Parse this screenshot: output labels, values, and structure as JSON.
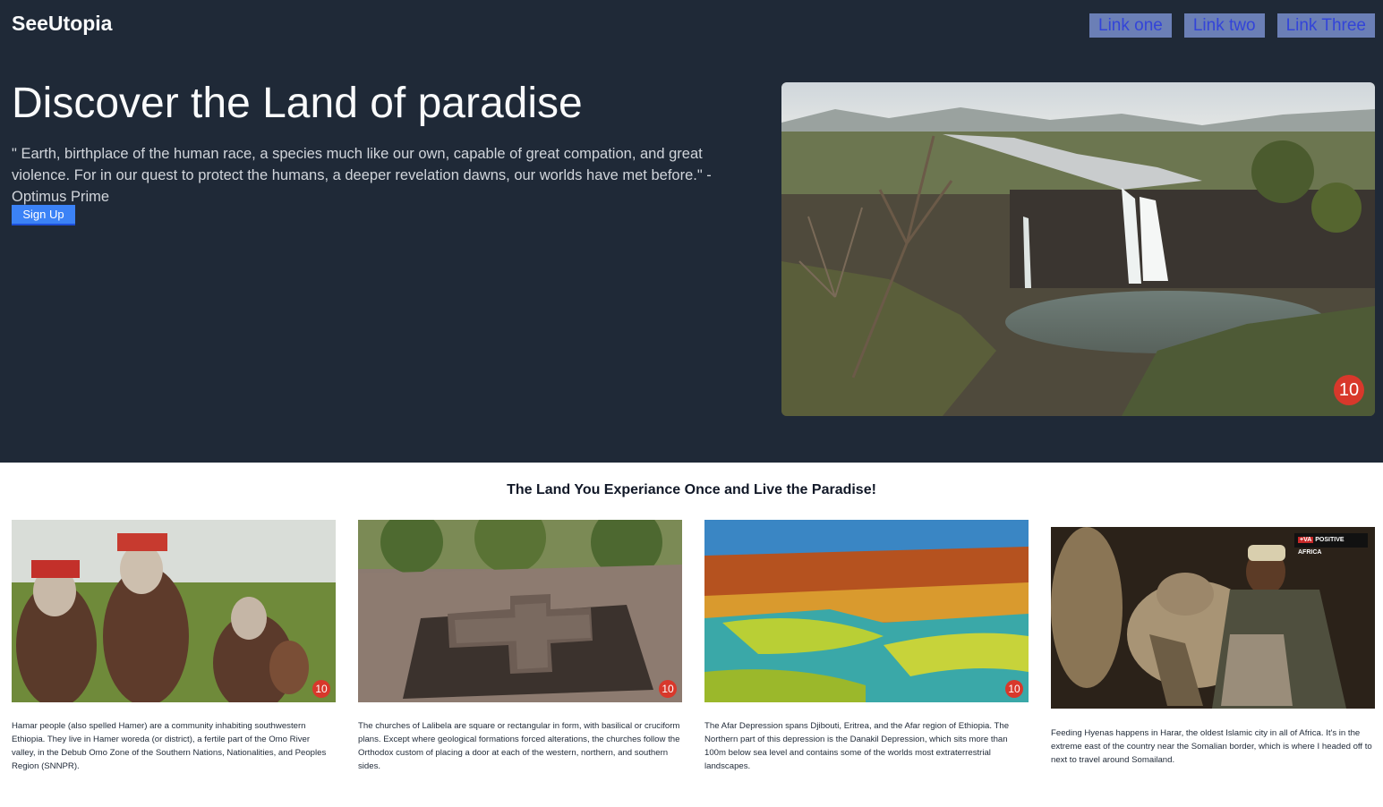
{
  "header": {
    "brand": "SeeUtopia",
    "links": [
      "Link one",
      "Link two",
      "Link Three"
    ]
  },
  "hero": {
    "title": "Discover the Land of paradise",
    "quote": "\" Earth, birthplace of the human race, a species much like our own, capable of great compation, and great violence. For in our quest to protect the humans, a deeper revelation dawns, our worlds have met before.\" - Optimus Prime",
    "signup_label": "Sign Up",
    "image_badge": "10"
  },
  "section": {
    "title": "The Land You Experiance Once and Live the Paradise!"
  },
  "cards": [
    {
      "text": "Hamar people (also spelled Hamer) are a community inhabiting southwestern Ethiopia. They live in Hamer woreda (or district), a fertile part of the Omo River valley, in the Debub Omo Zone of the Southern Nations, Nationalities, and Peoples Region (SNNPR).",
      "badge": "10"
    },
    {
      "text": "The churches of Lalibela are square or rectangular in form, with basilical or cruciform plans. Except where geological formations forced alterations, the churches follow the Orthodox custom of placing a door at each of the western, northern, and southern sides.",
      "badge": "10"
    },
    {
      "text": "The Afar Depression spans Djibouti, Eritrea, and the Afar region of Ethiopia. The Northern part of this depression is the Danakil Depression, which sits more than 100m below sea level and contains some of the worlds most extraterrestrial landscapes.",
      "badge": "10"
    },
    {
      "text": "Feeding Hyenas happens in Harar, the oldest Islamic city in all of Africa. It's in the extreme east of the country near the Somalian border, which is where I headed off to next to travel around Somailand.",
      "logo": "+VA POSITIVE AFRICA"
    }
  ]
}
